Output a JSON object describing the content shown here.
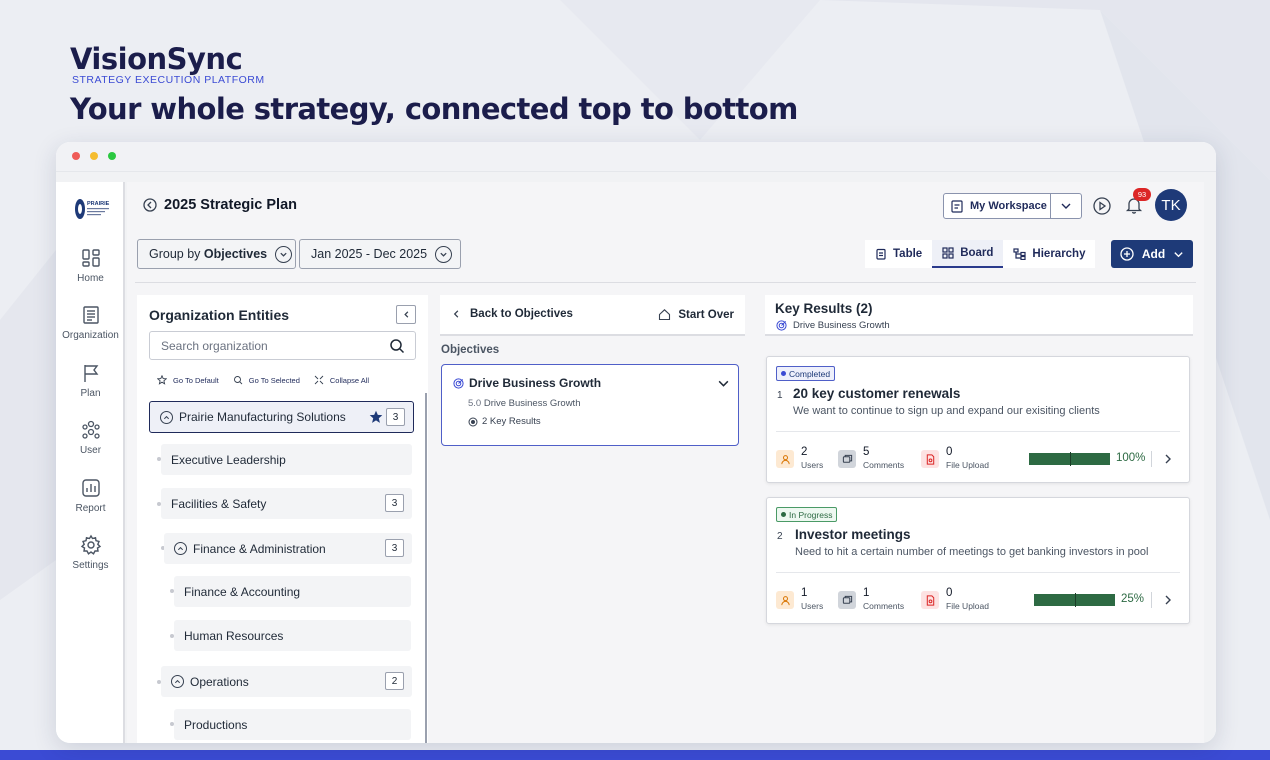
{
  "hero": {
    "brand": "VisionSync",
    "brand_sub": "STRATEGY EXECUTION PLATFORM",
    "tagline": "Your whole strategy, connected top to bottom"
  },
  "colors": {
    "accent": "#1e3a78",
    "brand_blue": "#3b4bd4",
    "success_green": "#2d6a43",
    "badge_red": "#dc2626"
  },
  "sidebar": {
    "logo_text": "PRAIRIE",
    "items": [
      {
        "label": "Home",
        "icon": "home-icon"
      },
      {
        "label": "Organization",
        "icon": "organization-icon"
      },
      {
        "label": "Plan",
        "icon": "flag-icon"
      },
      {
        "label": "User",
        "icon": "users-icon"
      },
      {
        "label": "Report",
        "icon": "report-icon"
      },
      {
        "label": "Settings",
        "icon": "gear-icon"
      }
    ]
  },
  "header": {
    "title": "2025 Strategic Plan",
    "workspace_label": "My Workspace",
    "notification_count": "93",
    "avatar_initials": "TK"
  },
  "filters": {
    "group_by_prefix": "Group by",
    "group_by_value": "Objectives",
    "date_range": "Jan 2025 - Dec 2025"
  },
  "view_tabs": [
    {
      "label": "Table",
      "active": false
    },
    {
      "label": "Board",
      "active": true
    },
    {
      "label": "Hierarchy",
      "active": false
    }
  ],
  "add_label": "Add",
  "entities": {
    "title": "Organization Entities",
    "search_placeholder": "Search organization",
    "actions": [
      "Go To Default",
      "Go To Selected",
      "Collapse All"
    ],
    "items": [
      {
        "label": "Prairie Manufacturing Solutions",
        "count": "3",
        "starred": true
      },
      {
        "label": "Executive Leadership",
        "count": ""
      },
      {
        "label": "Facilities & Safety",
        "count": "3"
      },
      {
        "label": "Finance & Administration",
        "count": "3"
      },
      {
        "label": "Finance & Accounting",
        "count": ""
      },
      {
        "label": "Human Resources",
        "count": ""
      },
      {
        "label": "Operations",
        "count": "2"
      },
      {
        "label": "Productions",
        "count": ""
      }
    ]
  },
  "objectives_panel": {
    "back_label": "Back to Objectives",
    "start_over_label": "Start Over",
    "section_label": "Objectives",
    "card": {
      "title": "Drive Business Growth",
      "number": "5.0",
      "subtitle": "Drive Business Growth",
      "key_results": "2 Key Results"
    }
  },
  "key_results_panel": {
    "title": "Key Results (2)",
    "subtitle": "Drive Business Growth",
    "items": [
      {
        "status": "Completed",
        "number": "1",
        "title": "20 key customer renewals",
        "description": "We want to continue to sign up and expand our exisiting clients",
        "users": "2",
        "comments": "5",
        "files": "0",
        "progress": 100,
        "progress_label": "100%"
      },
      {
        "status": "In Progress",
        "number": "2",
        "title": "Investor meetings",
        "description": "Need to hit a certain number of meetings to get banking investors in pool",
        "users": "1",
        "comments": "1",
        "files": "0",
        "progress": 25,
        "progress_label": "25%"
      }
    ],
    "stat_labels": {
      "users": "Users",
      "comments": "Comments",
      "files": "File Upload"
    }
  }
}
